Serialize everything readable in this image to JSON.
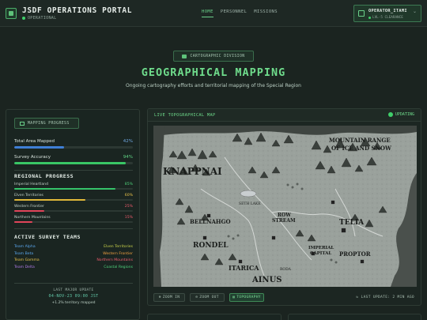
{
  "header": {
    "title": "JSDF OPERATIONS PORTAL",
    "status": "OPERATIONAL",
    "nav": [
      "HOME",
      "PERSONNEL",
      "MISSIONS"
    ],
    "active_nav": "HOME",
    "operator": "OPERATOR_ITAMI",
    "clearance": "LVL-5 CLEARANCE"
  },
  "hero": {
    "badge": "CARTOGRAPHIC DIVISION",
    "title": "GEOGRAPHICAL MAPPING",
    "subtitle": "Ongoing cartography efforts and territorial mapping of the Special Region"
  },
  "progress": {
    "badge": "MAPPING PROGRESS",
    "metrics": [
      {
        "label": "Total Area Mapped",
        "value": "42%",
        "fraction": 0.42,
        "color": "#3f7fd6"
      },
      {
        "label": "Survey Accuracy",
        "value": "94%",
        "fraction": 0.94,
        "color": "#39c765"
      }
    ]
  },
  "regional": {
    "title": "REGIONAL PROGRESS",
    "items": [
      {
        "label": "Imperial Heartland",
        "value": "85%",
        "fraction": 0.85,
        "color": "#35c36a",
        "vcolor": "#4ed07a"
      },
      {
        "label": "Elven Territories",
        "value": "60%",
        "fraction": 0.6,
        "color": "#e0b83a",
        "vcolor": "#e8c24a"
      },
      {
        "label": "Western Frontier",
        "value": "25%",
        "fraction": 0.25,
        "color": "#e0455a",
        "vcolor": "#ee5b6d"
      },
      {
        "label": "Northern Mountains",
        "value": "15%",
        "fraction": 0.15,
        "color": "#e0455a",
        "vcolor": "#ee5b6d"
      }
    ]
  },
  "teams": {
    "title": "ACTIVE SURVEY TEAMS",
    "items": [
      {
        "name": "Team Alpha",
        "area": "Elven Territories",
        "color": "#5aa8f0",
        "acolor": "#c9d24a"
      },
      {
        "name": "Team Beta",
        "area": "Western Frontier",
        "color": "#5aa8f0",
        "acolor": "#f0a040"
      },
      {
        "name": "Team Gamma",
        "area": "Northern Mountains",
        "color": "#e8c24a",
        "acolor": "#ee5b6d"
      },
      {
        "name": "Team Delta",
        "area": "Coastal Regions",
        "color": "#b07ae8",
        "acolor": "#4ed07a"
      }
    ]
  },
  "update": {
    "label": "LAST MAJOR UPDATE",
    "date": "04-NOV-23 09:00 JST",
    "note": "+1.2% territory mapped"
  },
  "map": {
    "title": "LIVE TOPOGRAPHICAL MAP",
    "status": "UPDATING",
    "labels": {
      "knappnai": "KNAPPNAI",
      "mountain": "MOUNTAIN RANGE",
      "mountain2": "OF ICE AND SNOW",
      "bellnahgo": "BELLNAHGO",
      "rondel": "RONDEL",
      "itarica": "ITARICA",
      "ainus": "AINUS",
      "telia": "TELIA",
      "rowstream": "ROW",
      "rowstream2": "STREAM",
      "imperial": "IMPERIAL",
      "imperial2": "CAPITAL",
      "proptor": "PROPTOR",
      "sethlake": "SETH LAKE",
      "roda": "RODA"
    },
    "zoom_in": "ZOOM IN",
    "zoom_out": "ZOOM OUT",
    "topography": "TOPOGRAPHY",
    "last_update": "LAST UPDATE: 2 MIN AGO"
  }
}
